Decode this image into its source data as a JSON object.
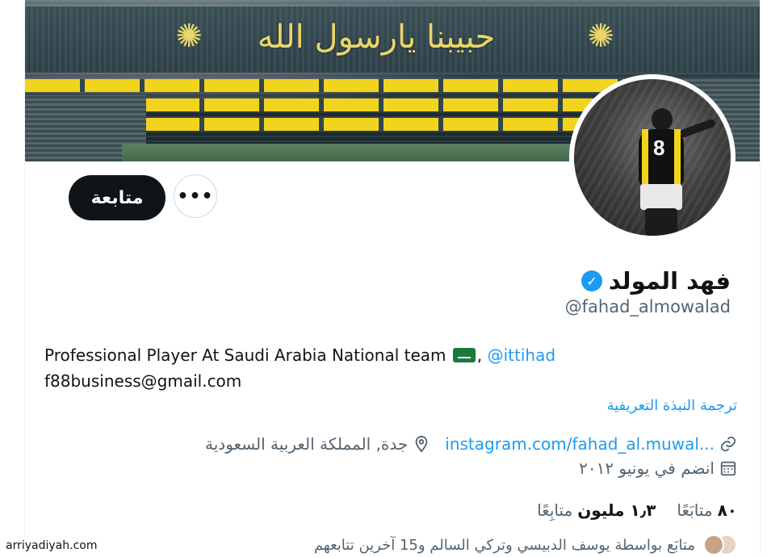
{
  "banner": {
    "calligraphy": "حبيبنا يارسول الله"
  },
  "actions": {
    "follow_label": "متابعة",
    "more_label": "•••"
  },
  "profile": {
    "display_name": "فهد المولد",
    "handle": "@fahad_almowalad",
    "bio_text": "Professional Player At Saudi Arabia National team ",
    "bio_mention_prefix": ", ",
    "bio_mention": "@ittihad",
    "bio_email": "f88business@gmail.com",
    "translate_label": "ترجمة النبذة التعريفية",
    "link": "instagram.com/fahad_al.muwal...",
    "location": "جدة, المملكة العربية السعودية",
    "joined": "انضم في يونيو ٢٠١٢"
  },
  "stats": {
    "following_count": "٨٠",
    "following_label": "متابَعًا",
    "followers_count": "١٫٣ مليون",
    "followers_label": "متابِعًا"
  },
  "followed_by": {
    "text": "متابَع بواسطة يوسف الدبيسي وتركي السالم و15 آخرين تتابعهم"
  },
  "watermark": "arriyadiyah.com",
  "colors": {
    "accent": "#1d9bf0",
    "text": "#0f1419",
    "muted": "#536471",
    "button_dark": "#0f1419"
  },
  "icons": {
    "verified": "verified-badge-icon",
    "link": "link-icon",
    "location": "location-pin-icon",
    "calendar": "calendar-icon"
  }
}
